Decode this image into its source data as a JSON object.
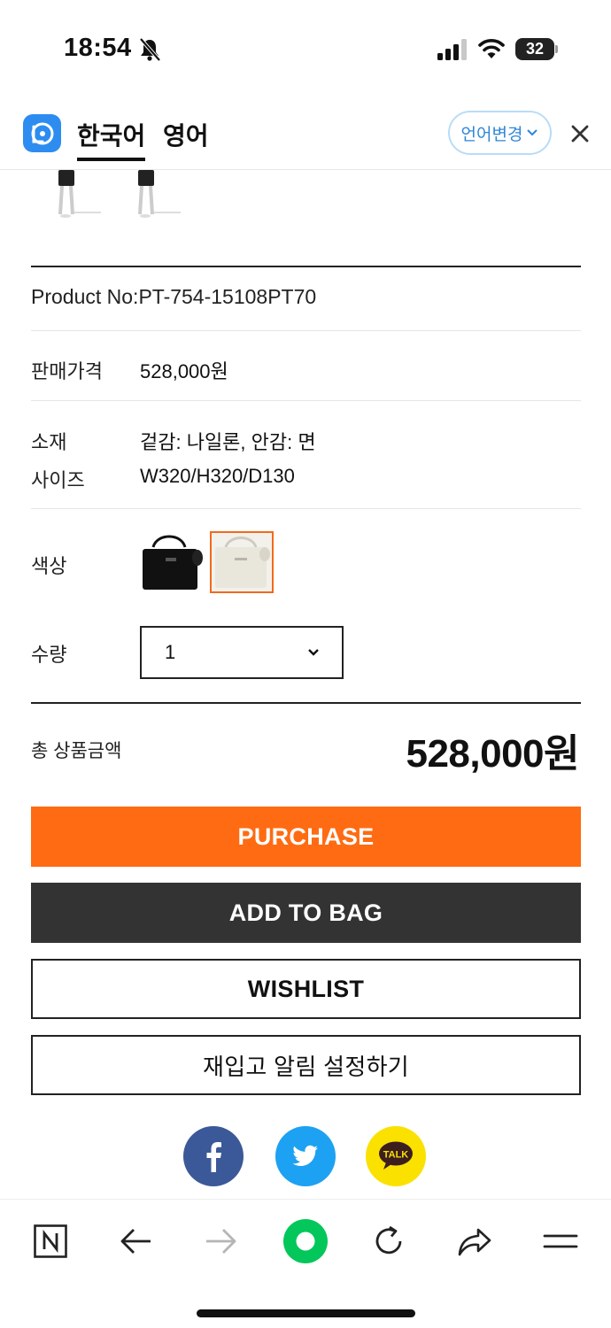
{
  "status_bar": {
    "time": "18:54",
    "battery": "32"
  },
  "translate_bar": {
    "tab_active": "한국어",
    "tab_other": "영어",
    "change_label": "언어변경"
  },
  "product": {
    "product_no": "Product No:PT-754-15108PT70",
    "price_label": "판매가격",
    "price_value": "528,000원",
    "material_label": "소재",
    "material_value": "겉감: 나일론, 안감: 면",
    "size_label": "사이즈",
    "size_value": "W320/H320/D130",
    "color_label": "색상",
    "quantity_label": "수량",
    "quantity_value": "1",
    "total_label": "총 상품금액",
    "total_value": "528,000원"
  },
  "buttons": {
    "purchase": "PURCHASE",
    "add_to_bag": "ADD TO BAG",
    "wishlist": "WISHLIST",
    "restock": "재입고 알림 설정하기"
  },
  "share": {
    "talk_label": "TALK"
  },
  "colors": {
    "accent": "#ff6b12",
    "dark_button": "#333333",
    "facebook": "#3b5998",
    "twitter": "#1da1f2",
    "kakao": "#fae100",
    "naver_green": "#03c75a"
  }
}
